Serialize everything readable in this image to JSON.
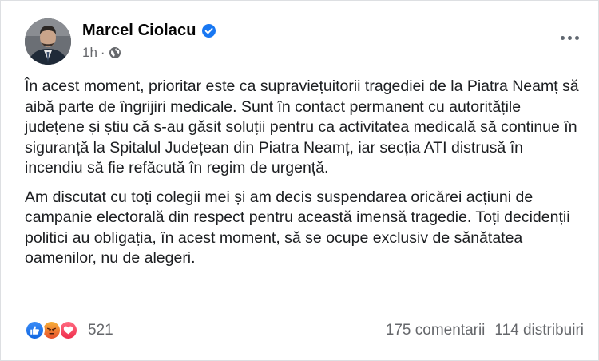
{
  "post": {
    "author": {
      "name": "Marcel Ciolacu",
      "verified_icon": "verified-badge-icon",
      "avatar_icon": "profile-photo"
    },
    "meta": {
      "time": "1h",
      "separator": "·",
      "audience_icon": "globe-icon"
    },
    "more_icon": "more-options-icon",
    "paragraphs": [
      "În acest moment, prioritar este ca supraviețuitorii tragediei de la Piatra Neamț să aibă parte de îngrijiri medicale. Sunt în contact permanent cu autoritățile județene și știu că s-au găsit soluții pentru ca activitatea medicală să continue în siguranță la Spitalul Județean din Piatra Neamț, iar secția ATI distrusă în incendiu să fie refăcută în regim de urgență.",
      "Am discutat cu toți colegii mei și am decis suspendarea oricărei acțiuni de campanie electorală din respect pentru această imensă tragedie. Toți decidenții politici au obligația, în acest moment, să se ocupe exclusiv de sănătatea oamenilor, nu de alegeri."
    ],
    "footer": {
      "reaction_icons": [
        "like-icon",
        "angry-icon",
        "love-icon"
      ],
      "reaction_count": "521",
      "comments": "175 comentarii",
      "shares": "114 distribuiri"
    },
    "colors": {
      "secondary_text": "#65676b",
      "verified": "#1877f2",
      "like": "#1877f2",
      "love": "#f33e58",
      "angry": "#f7b125"
    }
  }
}
